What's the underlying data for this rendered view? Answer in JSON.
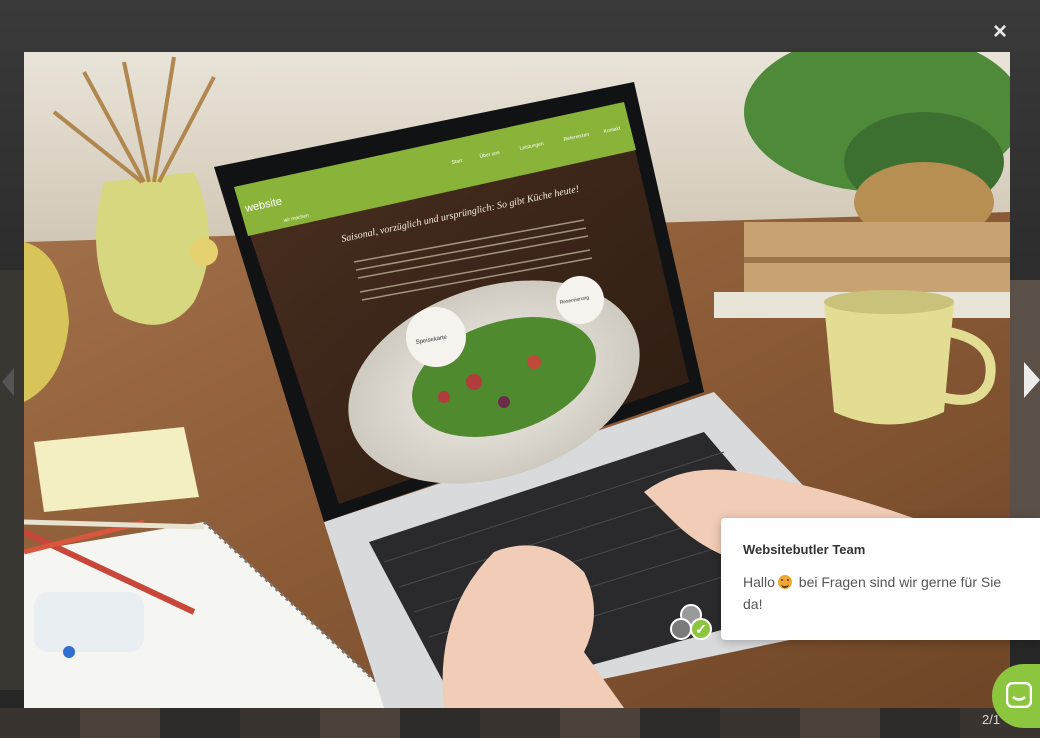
{
  "lightbox": {
    "close_label": "×",
    "counter": "2/1"
  },
  "photo": {
    "screen_logo": "website",
    "screen_logo_sub": "wir machen",
    "screen_nav": [
      "Start",
      "Über uns",
      "Leistungen",
      "Referenzen",
      "Kontakt"
    ],
    "screen_headline": "Saisonal, vorzüglich und ursprünglich: So gibt Küche heute!",
    "badge_left": "Speisekarte",
    "badge_right": "Reservierung"
  },
  "chat": {
    "title": "Websitebutler Team",
    "message_before": "Hallo",
    "message_after": "bei Fragen sind wir gerne für Sie da!"
  },
  "colors": {
    "accent_green": "#8cc63f",
    "overlay": "#2b2b2b"
  },
  "icons": {
    "close": "close-icon",
    "prev": "chevron-left-icon",
    "next": "chevron-right-icon",
    "launcher": "chat-bubble-icon"
  }
}
